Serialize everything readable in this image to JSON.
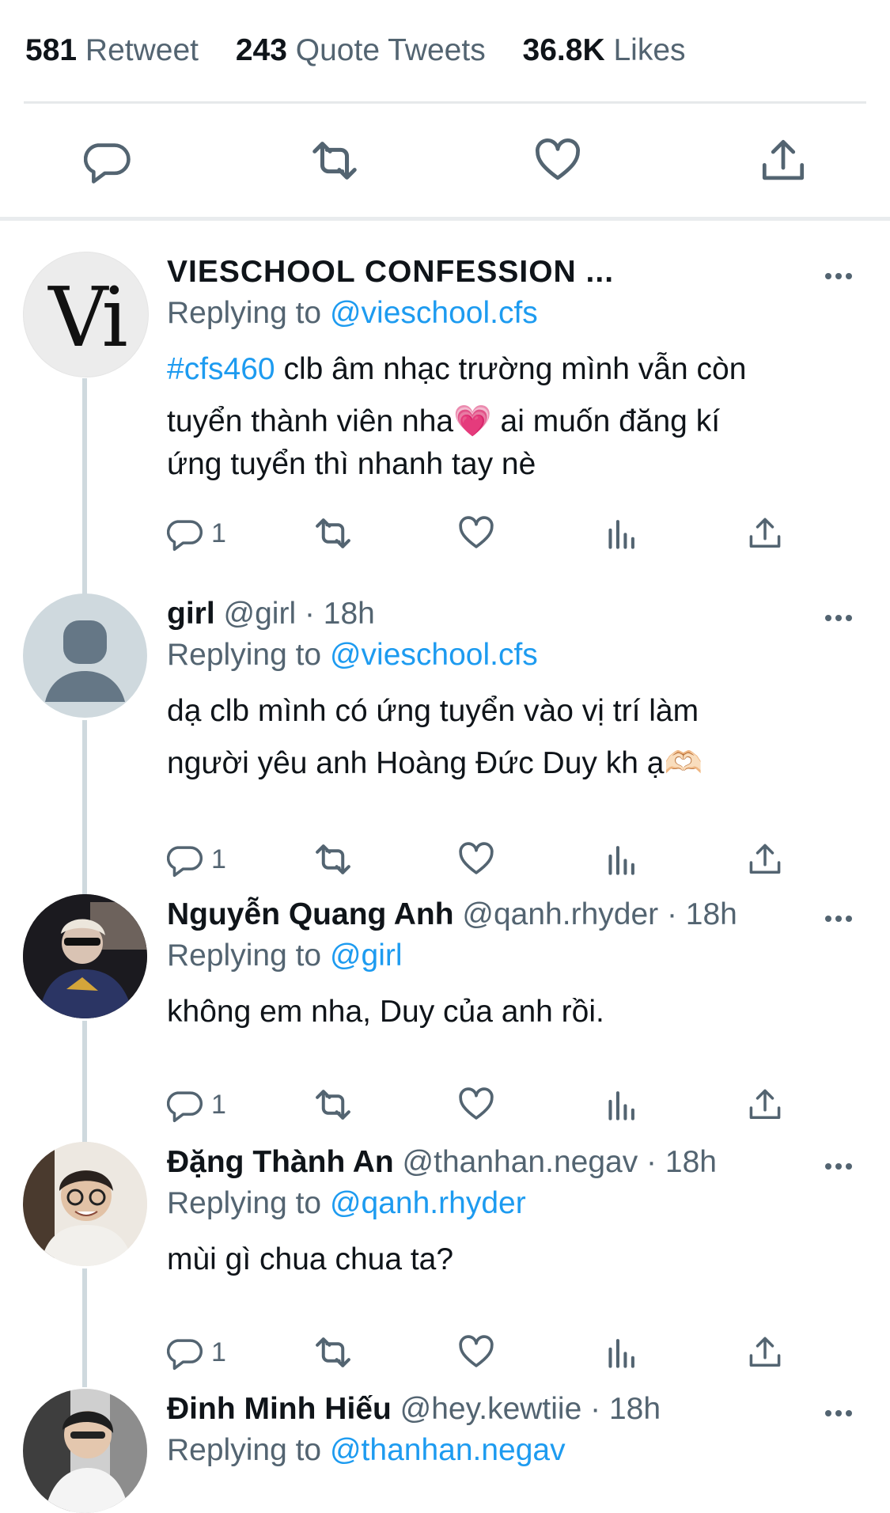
{
  "stats": {
    "retweets_count": "581",
    "retweets_label": "Retweet",
    "quotes_count": "243",
    "quotes_label": "Quote Tweets",
    "likes_count": "36.8K",
    "likes_label": "Likes"
  },
  "replies": [
    {
      "name": "VIESCHOOL CONFESSION ...",
      "handle": "",
      "time": "",
      "replying_prefix": "Replying to ",
      "replying_to": "@vieschool.cfs",
      "hashtag": "#cfs460",
      "text_line1": " clb âm nhạc trường mình vẫn còn",
      "text_line2": "tuyển thành viên nha💗  ai muốn đăng kí",
      "text_line3": "ứng tuyển thì nhanh tay nè",
      "reply_count": "1",
      "avatar_text": "Vi"
    },
    {
      "name": "girl",
      "handle": "@girl",
      "time": "18h",
      "replying_prefix": "Replying to ",
      "replying_to": "@vieschool.cfs",
      "text_line1": "dạ clb mình có ứng tuyển vào vị trí làm",
      "text_line2": "người yêu anh Hoàng Đức Duy kh ạ🫶🏻",
      "reply_count": "1"
    },
    {
      "name": "Nguyễn Quang Anh",
      "handle": "@qanh.rhyder",
      "time": "18h",
      "replying_prefix": "Replying to ",
      "replying_to": "@girl",
      "text_line1": "không em nha, Duy của anh rồi.",
      "reply_count": "1"
    },
    {
      "name": "Đặng Thành An",
      "handle": "@thanhan.negav",
      "time": "18h",
      "replying_prefix": "Replying to ",
      "replying_to": "@qanh.rhyder",
      "text_line1": "mùi gì chua chua ta?",
      "reply_count": "1"
    },
    {
      "name": "Đinh Minh Hiếu",
      "handle": "@hey.kewtiie",
      "time": "18h",
      "replying_prefix": "Replying to ",
      "replying_to": "@thanhan.negav"
    }
  ],
  "separator": " · ",
  "icons": [
    "reply-icon",
    "retweet-icon",
    "like-icon",
    "share-icon",
    "analytics-icon",
    "more-icon"
  ],
  "colors": {
    "link": "#1d9bf0",
    "muted": "#536471",
    "text": "#0f1419",
    "thread": "#cfd9de"
  }
}
